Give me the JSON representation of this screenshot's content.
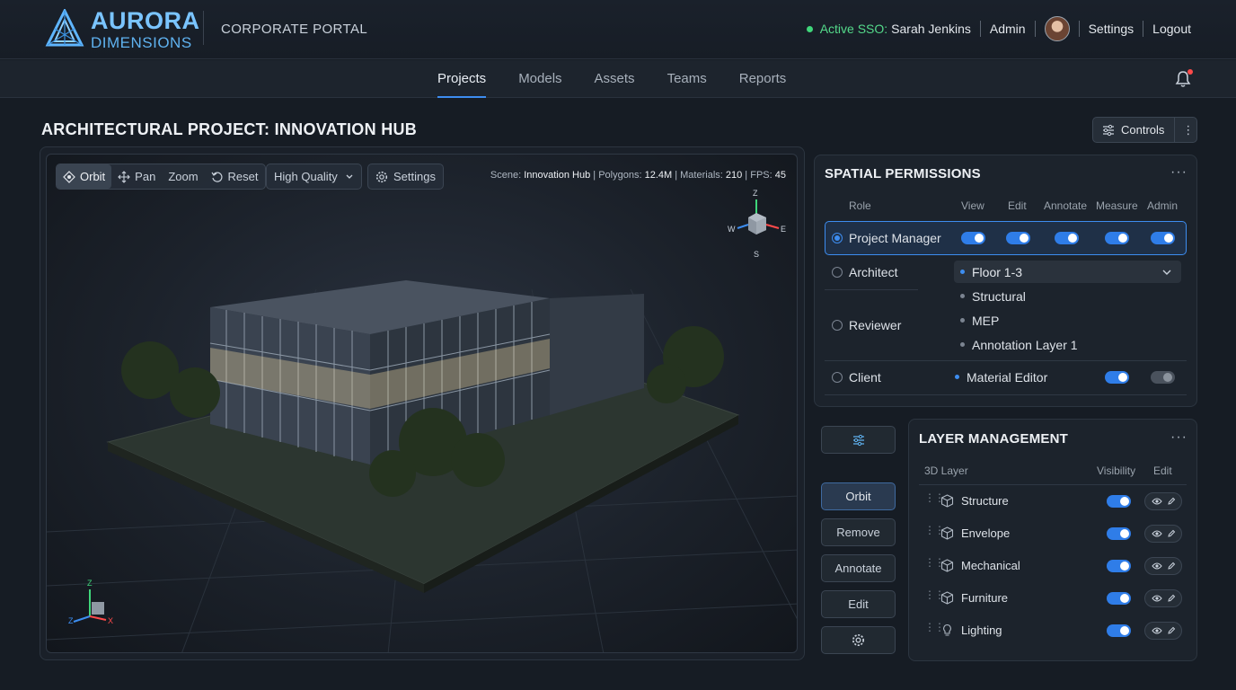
{
  "header": {
    "brand_line1": "AURORA",
    "brand_line2": "DIMENSIONS",
    "portal": "CORPORATE PORTAL",
    "sso_label": "Active SSO:",
    "user_name": "Sarah Jenkins",
    "role": "Admin",
    "settings": "Settings",
    "logout": "Logout",
    "status_color": "#3fd67a"
  },
  "nav": {
    "tabs": [
      "Projects",
      "Models",
      "Assets",
      "Teams",
      "Reports"
    ],
    "active": "Projects"
  },
  "page": {
    "title": "ARCHITECTURAL PROJECT: INNOVATION HUB",
    "controls_label": "Controls"
  },
  "viewer": {
    "tools": {
      "orbit": "Orbit",
      "pan": "Pan",
      "zoom": "Zoom",
      "reset": "Reset"
    },
    "quality": "High Quality",
    "settings": "Settings",
    "scene_label": "Scene:",
    "scene_name": "Innovation Hub",
    "polygons_label": "Polygons:",
    "polygons": "12.4M",
    "materials_label": "Materials:",
    "materials": "210",
    "fps_label": "FPS:",
    "fps": "45",
    "gizmo": {
      "z": "Z",
      "w": "W",
      "e": "E",
      "s": "S"
    },
    "axes": {
      "z": "Z",
      "x": "X"
    }
  },
  "permissions": {
    "title": "SPATIAL PERMISSIONS",
    "columns": [
      "Role",
      "View",
      "Edit",
      "Annotate",
      "Measure",
      "Admin"
    ],
    "roles": [
      "Project Manager",
      "Architect",
      "Reviewer",
      "Client"
    ],
    "selected_role": "Project Manager",
    "dropdown_value": "Floor 1-3",
    "layer_options": [
      "Structural",
      "MEP",
      "Annotation Layer 1"
    ],
    "client_item": "Material Editor"
  },
  "side_buttons": {
    "orbit": "Orbit",
    "remove": "Remove",
    "annotate": "Annotate",
    "edit": "Edit"
  },
  "layers": {
    "title": "LAYER MANAGEMENT",
    "col_layer": "3D Layer",
    "col_visibility": "Visibility",
    "col_edit": "Edit",
    "items": [
      {
        "name": "Structure",
        "icon": "cube-icon"
      },
      {
        "name": "Envelope",
        "icon": "cube-icon"
      },
      {
        "name": "Mechanical",
        "icon": "cube-icon"
      },
      {
        "name": "Furniture",
        "icon": "cube-icon"
      },
      {
        "name": "Lighting",
        "icon": "bulb-icon"
      }
    ]
  },
  "colors": {
    "accent": "#3d8df0",
    "background": "#161c24",
    "toggle_on": "#2f7de8"
  }
}
